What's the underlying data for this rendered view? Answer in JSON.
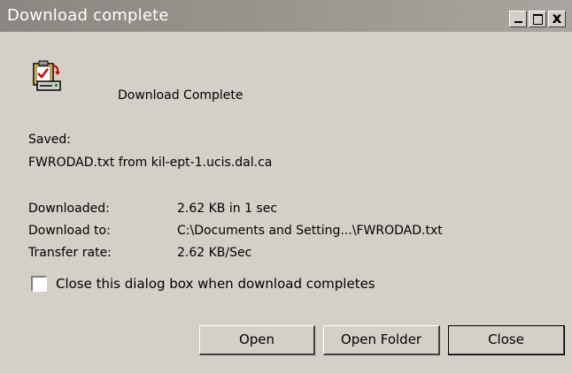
{
  "window": {
    "title": "Download complete",
    "controls": {
      "minimize": "_",
      "maximize": "□",
      "close": "x"
    }
  },
  "icon": "download-complete-icon",
  "headline": "Download Complete",
  "saved": {
    "label": "Saved:",
    "value": "FWRODAD.txt from kil-ept-1.ucis.dal.ca"
  },
  "details": [
    {
      "label": "Downloaded:",
      "value": "2.62 KB in 1 sec"
    },
    {
      "label": "Download to:",
      "value": "C:\\Documents and Setting...\\FWRODAD.txt"
    },
    {
      "label": "Transfer rate:",
      "value": "2.62 KB/Sec"
    }
  ],
  "close_when_done": {
    "label": "Close this dialog box when download completes",
    "checked": false
  },
  "buttons": {
    "open": "Open",
    "open_folder": "Open Folder",
    "close": "Close"
  },
  "colors": {
    "dialog_bg": "#d4d0c8",
    "titlebar": "#9a968e",
    "title_text": "#ffffff"
  }
}
